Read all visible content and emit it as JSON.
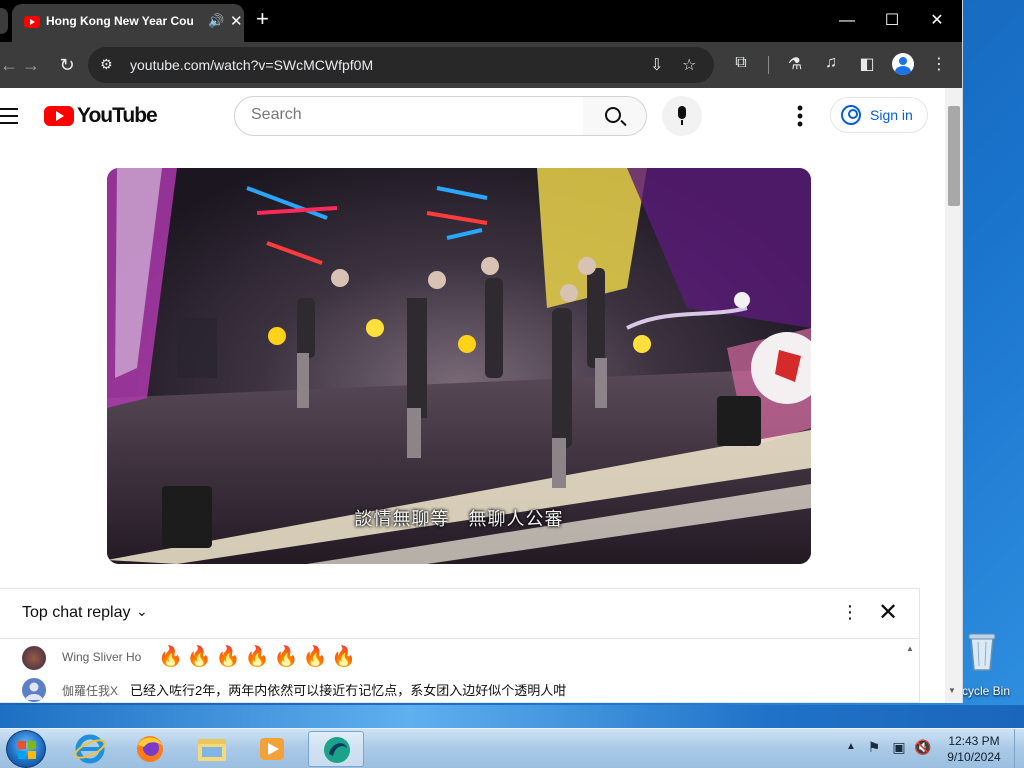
{
  "browser": {
    "tab_title": "Hong Kong New Year Cou",
    "tab_audio_icon": "speaker-icon",
    "url": "youtube.com/watch?v=SWcMCWfpf0M",
    "window_controls": {
      "minimize": "—",
      "maximize": "☐",
      "close": "✕"
    }
  },
  "youtube": {
    "wordmark": "YouTube",
    "search_placeholder": "Search",
    "sign_in_label": "Sign in"
  },
  "video": {
    "subtitle": "談情無聊等　無聊人公審"
  },
  "chat": {
    "title": "Top chat replay",
    "messages": [
      {
        "author": "Wing Sliver Ho",
        "text": "🔥🔥🔥🔥🔥🔥🔥"
      },
      {
        "author": "伽羅任我X",
        "text": "已经入咗行2年，两年内依然可以接近冇记忆点，系女团入边好似个透明人咁"
      }
    ]
  },
  "desktop": {
    "recycle_bin_label": "cycle Bin"
  },
  "taskbar": {
    "time": "12:43 PM",
    "date": "9/10/2024",
    "apps": [
      "internet-explorer-icon",
      "firefox-icon",
      "file-explorer-icon",
      "media-player-icon",
      "active-app-icon"
    ]
  },
  "colors": {
    "youtube_red": "#ff0000",
    "link_blue": "#065fd4",
    "chrome_dark": "#3c3c3c"
  }
}
